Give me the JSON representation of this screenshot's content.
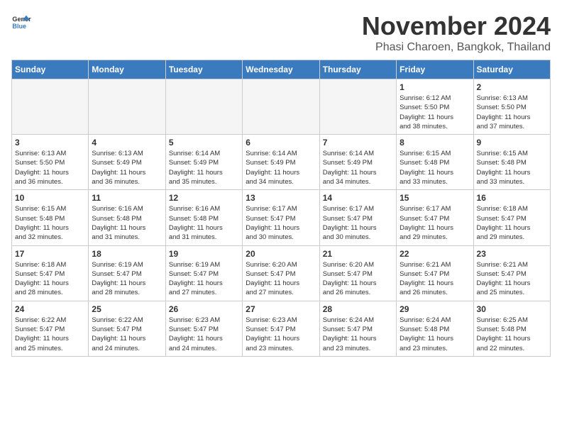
{
  "logo": {
    "line1": "General",
    "line2": "Blue"
  },
  "title": "November 2024",
  "location": "Phasi Charoen, Bangkok, Thailand",
  "weekdays": [
    "Sunday",
    "Monday",
    "Tuesday",
    "Wednesday",
    "Thursday",
    "Friday",
    "Saturday"
  ],
  "weeks": [
    [
      {
        "day": "",
        "info": "",
        "empty": true
      },
      {
        "day": "",
        "info": "",
        "empty": true
      },
      {
        "day": "",
        "info": "",
        "empty": true
      },
      {
        "day": "",
        "info": "",
        "empty": true
      },
      {
        "day": "",
        "info": "",
        "empty": true
      },
      {
        "day": "1",
        "info": "Sunrise: 6:12 AM\nSunset: 5:50 PM\nDaylight: 11 hours\nand 38 minutes.",
        "empty": false
      },
      {
        "day": "2",
        "info": "Sunrise: 6:13 AM\nSunset: 5:50 PM\nDaylight: 11 hours\nand 37 minutes.",
        "empty": false
      }
    ],
    [
      {
        "day": "3",
        "info": "Sunrise: 6:13 AM\nSunset: 5:50 PM\nDaylight: 11 hours\nand 36 minutes.",
        "empty": false
      },
      {
        "day": "4",
        "info": "Sunrise: 6:13 AM\nSunset: 5:49 PM\nDaylight: 11 hours\nand 36 minutes.",
        "empty": false
      },
      {
        "day": "5",
        "info": "Sunrise: 6:14 AM\nSunset: 5:49 PM\nDaylight: 11 hours\nand 35 minutes.",
        "empty": false
      },
      {
        "day": "6",
        "info": "Sunrise: 6:14 AM\nSunset: 5:49 PM\nDaylight: 11 hours\nand 34 minutes.",
        "empty": false
      },
      {
        "day": "7",
        "info": "Sunrise: 6:14 AM\nSunset: 5:49 PM\nDaylight: 11 hours\nand 34 minutes.",
        "empty": false
      },
      {
        "day": "8",
        "info": "Sunrise: 6:15 AM\nSunset: 5:48 PM\nDaylight: 11 hours\nand 33 minutes.",
        "empty": false
      },
      {
        "day": "9",
        "info": "Sunrise: 6:15 AM\nSunset: 5:48 PM\nDaylight: 11 hours\nand 33 minutes.",
        "empty": false
      }
    ],
    [
      {
        "day": "10",
        "info": "Sunrise: 6:15 AM\nSunset: 5:48 PM\nDaylight: 11 hours\nand 32 minutes.",
        "empty": false
      },
      {
        "day": "11",
        "info": "Sunrise: 6:16 AM\nSunset: 5:48 PM\nDaylight: 11 hours\nand 31 minutes.",
        "empty": false
      },
      {
        "day": "12",
        "info": "Sunrise: 6:16 AM\nSunset: 5:48 PM\nDaylight: 11 hours\nand 31 minutes.",
        "empty": false
      },
      {
        "day": "13",
        "info": "Sunrise: 6:17 AM\nSunset: 5:47 PM\nDaylight: 11 hours\nand 30 minutes.",
        "empty": false
      },
      {
        "day": "14",
        "info": "Sunrise: 6:17 AM\nSunset: 5:47 PM\nDaylight: 11 hours\nand 30 minutes.",
        "empty": false
      },
      {
        "day": "15",
        "info": "Sunrise: 6:17 AM\nSunset: 5:47 PM\nDaylight: 11 hours\nand 29 minutes.",
        "empty": false
      },
      {
        "day": "16",
        "info": "Sunrise: 6:18 AM\nSunset: 5:47 PM\nDaylight: 11 hours\nand 29 minutes.",
        "empty": false
      }
    ],
    [
      {
        "day": "17",
        "info": "Sunrise: 6:18 AM\nSunset: 5:47 PM\nDaylight: 11 hours\nand 28 minutes.",
        "empty": false
      },
      {
        "day": "18",
        "info": "Sunrise: 6:19 AM\nSunset: 5:47 PM\nDaylight: 11 hours\nand 28 minutes.",
        "empty": false
      },
      {
        "day": "19",
        "info": "Sunrise: 6:19 AM\nSunset: 5:47 PM\nDaylight: 11 hours\nand 27 minutes.",
        "empty": false
      },
      {
        "day": "20",
        "info": "Sunrise: 6:20 AM\nSunset: 5:47 PM\nDaylight: 11 hours\nand 27 minutes.",
        "empty": false
      },
      {
        "day": "21",
        "info": "Sunrise: 6:20 AM\nSunset: 5:47 PM\nDaylight: 11 hours\nand 26 minutes.",
        "empty": false
      },
      {
        "day": "22",
        "info": "Sunrise: 6:21 AM\nSunset: 5:47 PM\nDaylight: 11 hours\nand 26 minutes.",
        "empty": false
      },
      {
        "day": "23",
        "info": "Sunrise: 6:21 AM\nSunset: 5:47 PM\nDaylight: 11 hours\nand 25 minutes.",
        "empty": false
      }
    ],
    [
      {
        "day": "24",
        "info": "Sunrise: 6:22 AM\nSunset: 5:47 PM\nDaylight: 11 hours\nand 25 minutes.",
        "empty": false
      },
      {
        "day": "25",
        "info": "Sunrise: 6:22 AM\nSunset: 5:47 PM\nDaylight: 11 hours\nand 24 minutes.",
        "empty": false
      },
      {
        "day": "26",
        "info": "Sunrise: 6:23 AM\nSunset: 5:47 PM\nDaylight: 11 hours\nand 24 minutes.",
        "empty": false
      },
      {
        "day": "27",
        "info": "Sunrise: 6:23 AM\nSunset: 5:47 PM\nDaylight: 11 hours\nand 23 minutes.",
        "empty": false
      },
      {
        "day": "28",
        "info": "Sunrise: 6:24 AM\nSunset: 5:47 PM\nDaylight: 11 hours\nand 23 minutes.",
        "empty": false
      },
      {
        "day": "29",
        "info": "Sunrise: 6:24 AM\nSunset: 5:48 PM\nDaylight: 11 hours\nand 23 minutes.",
        "empty": false
      },
      {
        "day": "30",
        "info": "Sunrise: 6:25 AM\nSunset: 5:48 PM\nDaylight: 11 hours\nand 22 minutes.",
        "empty": false
      }
    ]
  ]
}
